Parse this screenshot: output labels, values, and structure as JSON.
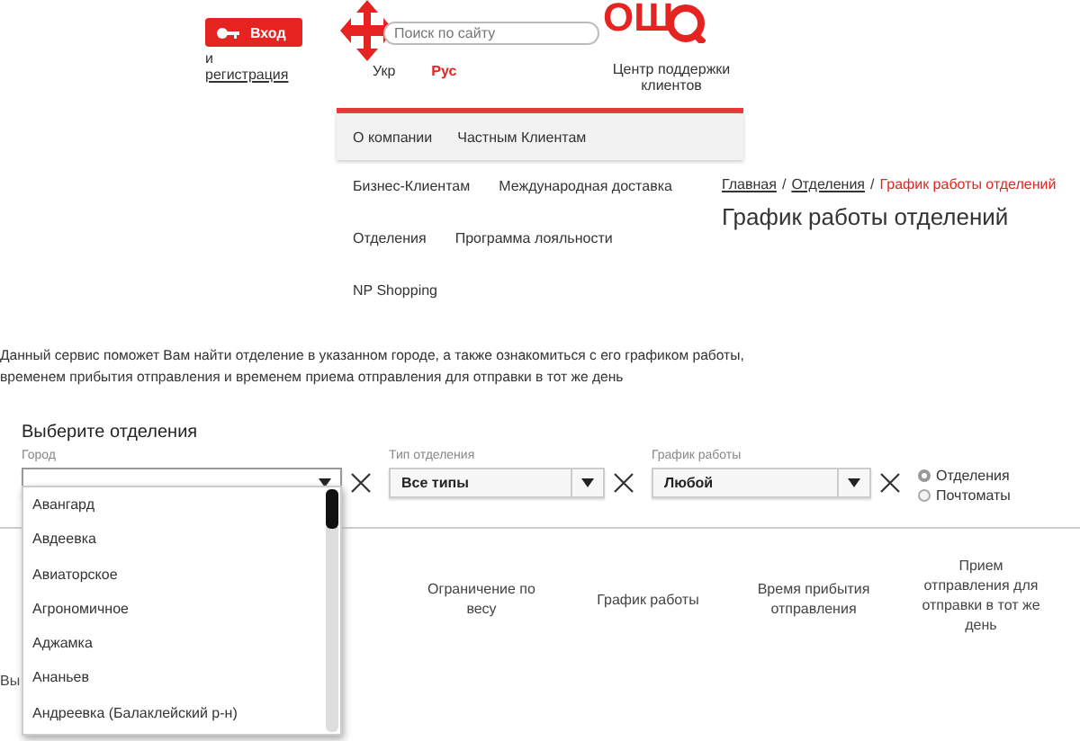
{
  "login": {
    "button": "Вход",
    "conjunction": "и",
    "link": "регистрация"
  },
  "logo": {
    "text": "ОШ"
  },
  "search": {
    "placeholder": "Поиск по сайту"
  },
  "languages": [
    {
      "label": "Укр",
      "selected": false
    },
    {
      "label": "Рус",
      "selected": true
    }
  ],
  "support_link": "Центр поддержки клиентов",
  "menu": {
    "top": [
      "О компании",
      "Частным Клиентам"
    ],
    "rows": [
      [
        "Бизнес-Клиентам",
        "Международная доставка"
      ],
      [
        "Отделения",
        "Программа лояльности"
      ],
      [
        "NP Shopping"
      ]
    ]
  },
  "breadcrumb": {
    "links": [
      "Главная",
      "Отделения"
    ],
    "separator": "/",
    "current": "График работы отделений"
  },
  "page_title": "График работы отделений",
  "intro": [
    "Данный сервис поможет Вам найти отделение в указанном городе, а также ознакомиться с его графиком работы,",
    "временем прибытия отправления и временем приема отправления для отправки в тот же день"
  ],
  "filters": {
    "title": "Выберите отделения",
    "fields": [
      {
        "label": "Город"
      },
      {
        "label": "Тип отделения",
        "value": "Все типы"
      },
      {
        "label": "График работы",
        "value": "Любой"
      }
    ],
    "options": [
      {
        "label": "Отделения",
        "selected": true
      },
      {
        "label": "Почтоматы",
        "selected": false
      }
    ]
  },
  "city_dropdown": [
    "Авангард",
    "Авдеевка",
    "Авиаторское",
    "Агрономичное",
    "Аджамка",
    "Ананьев",
    "Андреевка (Балаклейский р-н)"
  ],
  "table": {
    "column_1": "Вы",
    "columns": [
      "Ограничение по весу",
      "График работы",
      "Время прибытия отправления",
      "Прием отправления для отправки в тот же день"
    ]
  }
}
